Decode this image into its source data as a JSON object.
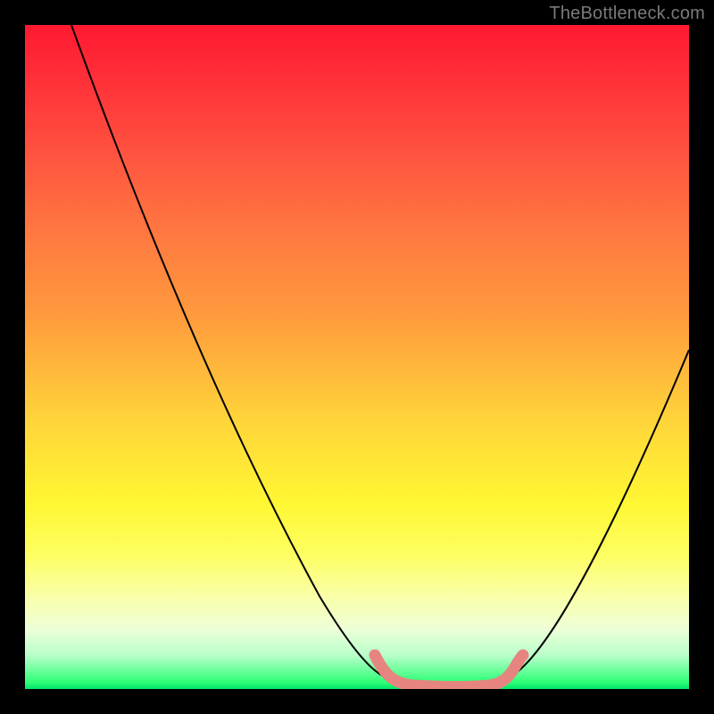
{
  "watermark": "TheBottleneck.com",
  "chart_data": {
    "type": "line",
    "title": "",
    "xlabel": "",
    "ylabel": "",
    "xlim": [
      0,
      100
    ],
    "ylim": [
      0,
      100
    ],
    "grid": false,
    "series": [
      {
        "name": "black-left-curve",
        "color": "#000000",
        "x": [
          7,
          12,
          18,
          24,
          30,
          36,
          42,
          47,
          51,
          55
        ],
        "values": [
          100,
          87,
          73,
          59,
          46,
          33,
          21,
          11,
          5,
          2
        ]
      },
      {
        "name": "black-right-curve",
        "color": "#000000",
        "x": [
          73,
          78,
          83,
          88,
          93,
          98,
          100
        ],
        "values": [
          2,
          6,
          13,
          22,
          33,
          45,
          51
        ]
      },
      {
        "name": "pink-trough",
        "color": "#e6857f",
        "x": [
          53,
          55,
          57,
          59,
          62,
          65,
          68,
          70,
          72,
          73,
          75
        ],
        "values": [
          5,
          2,
          1,
          0.5,
          0.3,
          0.3,
          0.5,
          1,
          2,
          3,
          5
        ]
      }
    ]
  }
}
